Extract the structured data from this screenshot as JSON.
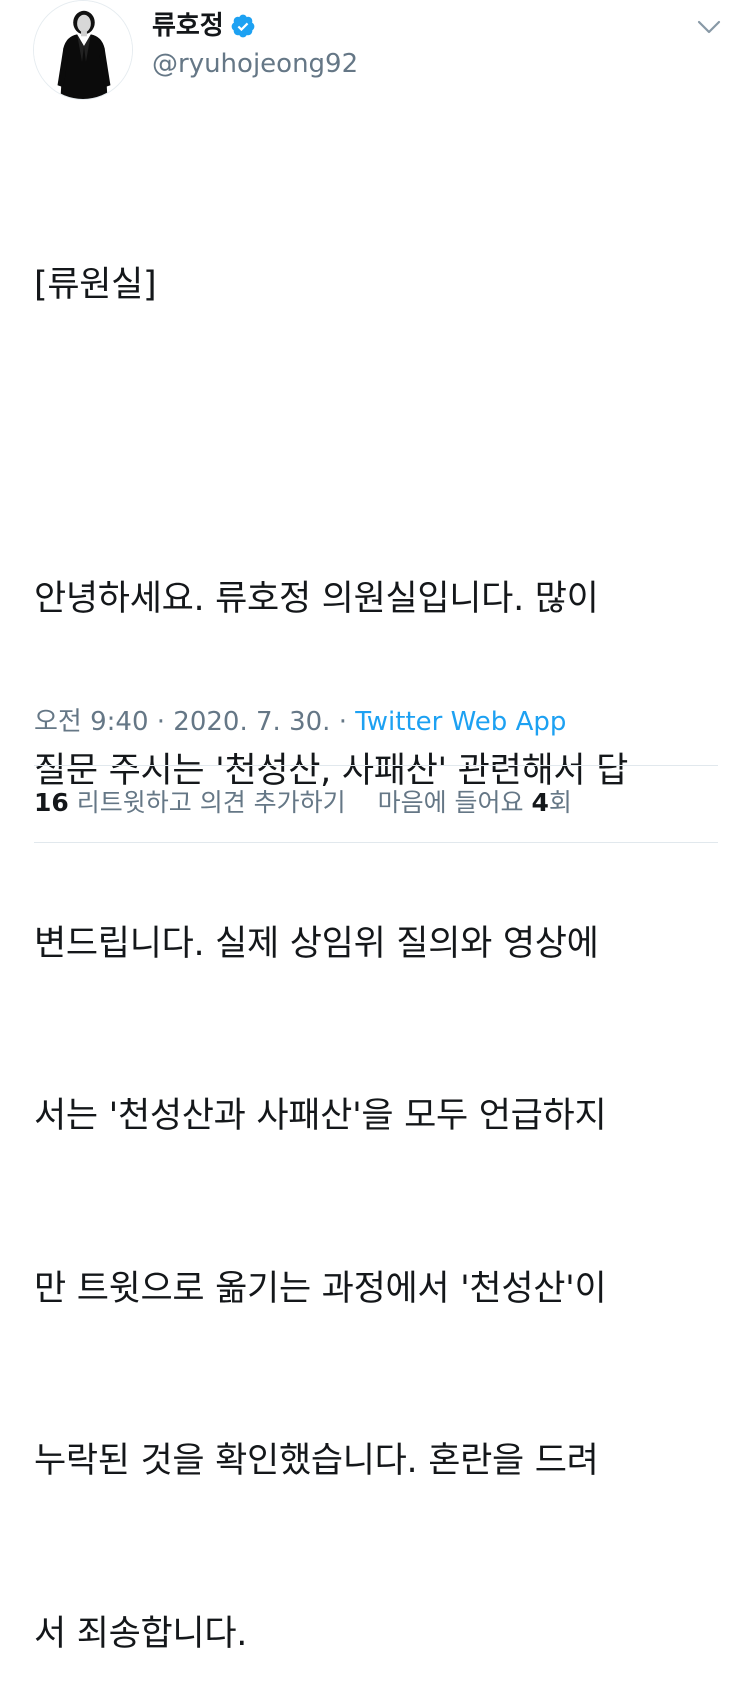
{
  "tweet": {
    "author": {
      "display_name": "류호정",
      "handle": "@ryuhojeong92",
      "verified": true,
      "avatar_icon": "profile-photo"
    },
    "header_label": "[류원실]",
    "body_lines": [
      "안녕하세요. 류호정 의원실입니다. 많이",
      "질문 주시는 '천성산, 사패산' 관련해서 답",
      "변드립니다. 실제 상임위 질의와 영상에",
      "서는 '천성산과 사패산'을 모두 언급하지",
      "만 트윗으로 옮기는 과정에서 '천성산'이",
      "누락된 것을 확인했습니다. 혼란을 드려",
      "서 죄송합니다."
    ],
    "time": "오전 9:40",
    "date": "2020. 7. 30.",
    "separator": "·",
    "source": "Twitter Web App",
    "retweets_count": "16",
    "retweets_label": "리트윗하고 의견 추가하기",
    "likes_label": "마음에 들어요",
    "likes_count": "4",
    "likes_suffix": "회"
  },
  "colors": {
    "text": "#14171a",
    "secondary": "#657786",
    "link": "#1da1f2",
    "divider": "#e1e8ed",
    "verified": "#1da1f2"
  },
  "icons": {
    "verified": "verified-badge-icon",
    "menu": "chevron-down-icon"
  }
}
